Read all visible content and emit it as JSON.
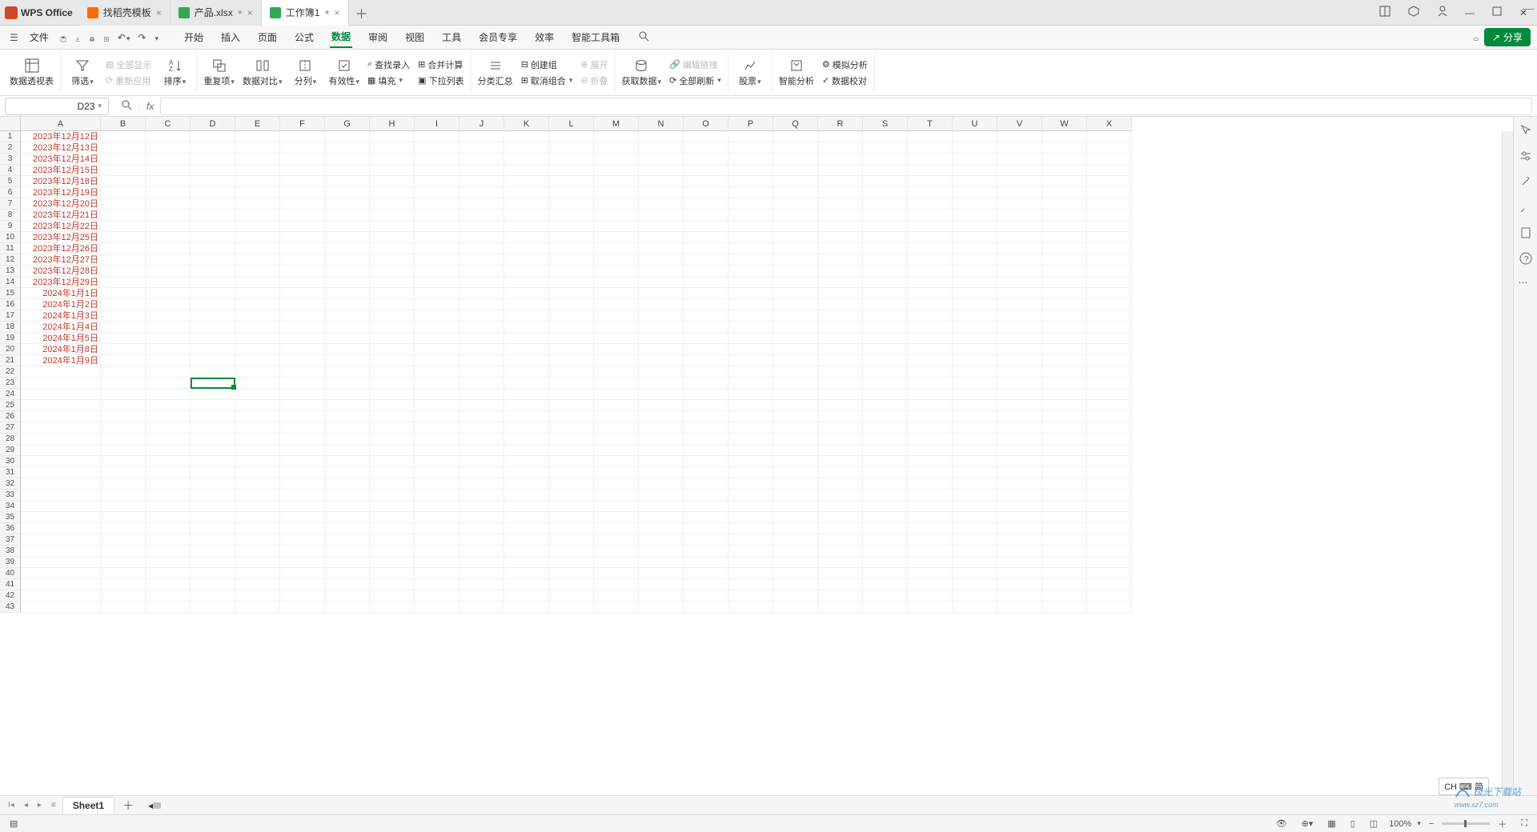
{
  "brand": "WPS Office",
  "tabs": [
    {
      "label": "找稻壳模板",
      "type": "d"
    },
    {
      "label": "产品.xlsx",
      "type": "s",
      "dirty": true
    },
    {
      "label": "工作簿1",
      "type": "s",
      "dirty": true,
      "active": true
    }
  ],
  "menu_file": "文件",
  "menu_items": [
    "开始",
    "插入",
    "页面",
    "公式",
    "数据",
    "审阅",
    "视图",
    "工具",
    "会员专享",
    "效率",
    "智能工具箱"
  ],
  "menu_active": "数据",
  "share_label": "分享",
  "ribbon": {
    "pivot": "数据透视表",
    "filter": "筛选",
    "show_all": "全部显示",
    "reapply": "重新应用",
    "sort": "排序",
    "dup": "重复项",
    "compare": "数据对比",
    "text2col": "分列",
    "validity": "有效性",
    "fill": "填充",
    "lookup": "查找录入",
    "merge": "合并计算",
    "dropdown": "下拉列表",
    "subtotal": "分类汇总",
    "group": "创建组",
    "ungroup": "取消组合",
    "expand": "展开",
    "collapse": "折叠",
    "getdata": "获取数据",
    "edit_link": "编辑链接",
    "refresh_all": "全部刷新",
    "stock": "股票",
    "ai_analyze": "智能分析",
    "sim": "模拟分析",
    "data_audit": "数据校对"
  },
  "name_box": "D23",
  "fx_label": "fx",
  "columns": [
    "A",
    "B",
    "C",
    "D",
    "E",
    "F",
    "G",
    "H",
    "I",
    "J",
    "K",
    "L",
    "M",
    "N",
    "O",
    "P",
    "Q",
    "R",
    "S",
    "T",
    "U",
    "V",
    "W",
    "X"
  ],
  "row_count": 43,
  "cell_data": [
    "2023年12月12日",
    "2023年12月13日",
    "2023年12月14日",
    "2023年12月15日",
    "2023年12月18日",
    "2023年12月19日",
    "2023年12月20日",
    "2023年12月21日",
    "2023年12月22日",
    "2023年12月25日",
    "2023年12月26日",
    "2023年12月27日",
    "2023年12月28日",
    "2023年12月29日",
    "2024年1月1日",
    "2024年1月2日",
    "2024年1月3日",
    "2024年1月4日",
    "2024年1月5日",
    "2024年1月8日",
    "2024年1月9日"
  ],
  "selected": {
    "col": "D",
    "row": 23
  },
  "sheet_name": "Sheet1",
  "zoom": "100%",
  "ime_tip": "CH ⌨ 简",
  "watermark": "极光下载站",
  "watermark_url": "www.xz7.com"
}
